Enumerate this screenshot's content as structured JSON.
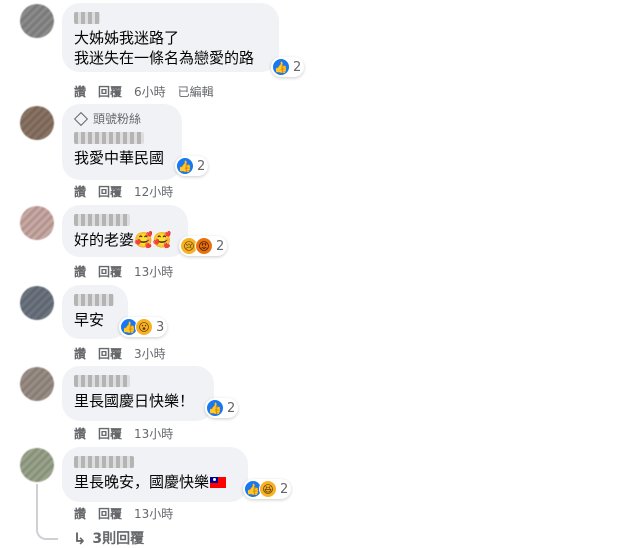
{
  "comments": [
    {
      "text_lines": [
        "大姊姊我迷路了",
        "我迷失在一條名為戀愛的路"
      ],
      "reaction_count": "2",
      "reply": "回覆",
      "like": "讚",
      "time": "6小時",
      "edited": "已編輯"
    },
    {
      "badge": "頭號粉絲",
      "text_lines": [
        "我愛中華民國"
      ],
      "reaction_count": "2",
      "reply": "回覆",
      "like": "讚",
      "time": "12小時"
    },
    {
      "text_lines": [
        "好的老婆🥰🥰"
      ],
      "reaction_count": "2",
      "reply": "回覆",
      "like": "讚",
      "time": "13小時"
    },
    {
      "text_lines": [
        "早安"
      ],
      "reaction_count": "3",
      "reply": "回覆",
      "like": "讚",
      "time": "3小時"
    },
    {
      "text_lines": [
        "里長國慶日快樂！"
      ],
      "reaction_count": "2",
      "reply": "回覆",
      "like": "讚",
      "time": "13小時"
    },
    {
      "text_lines": [
        "里長晚安，國慶快樂"
      ],
      "reaction_count": "2",
      "reply": "回覆",
      "like": "讚",
      "time": "13小時"
    }
  ],
  "more_replies": "3則回覆",
  "colors": {
    "like_blue": "#1877f2",
    "bubble_gray": "#f0f2f5",
    "secondary_text": "#65676b"
  },
  "icons": [
    "like-icon",
    "love-icon",
    "sad-icon",
    "angry-icon",
    "wow-icon",
    "haha-icon",
    "diamond-icon",
    "reply-arrow-icon",
    "flag-icon"
  ]
}
